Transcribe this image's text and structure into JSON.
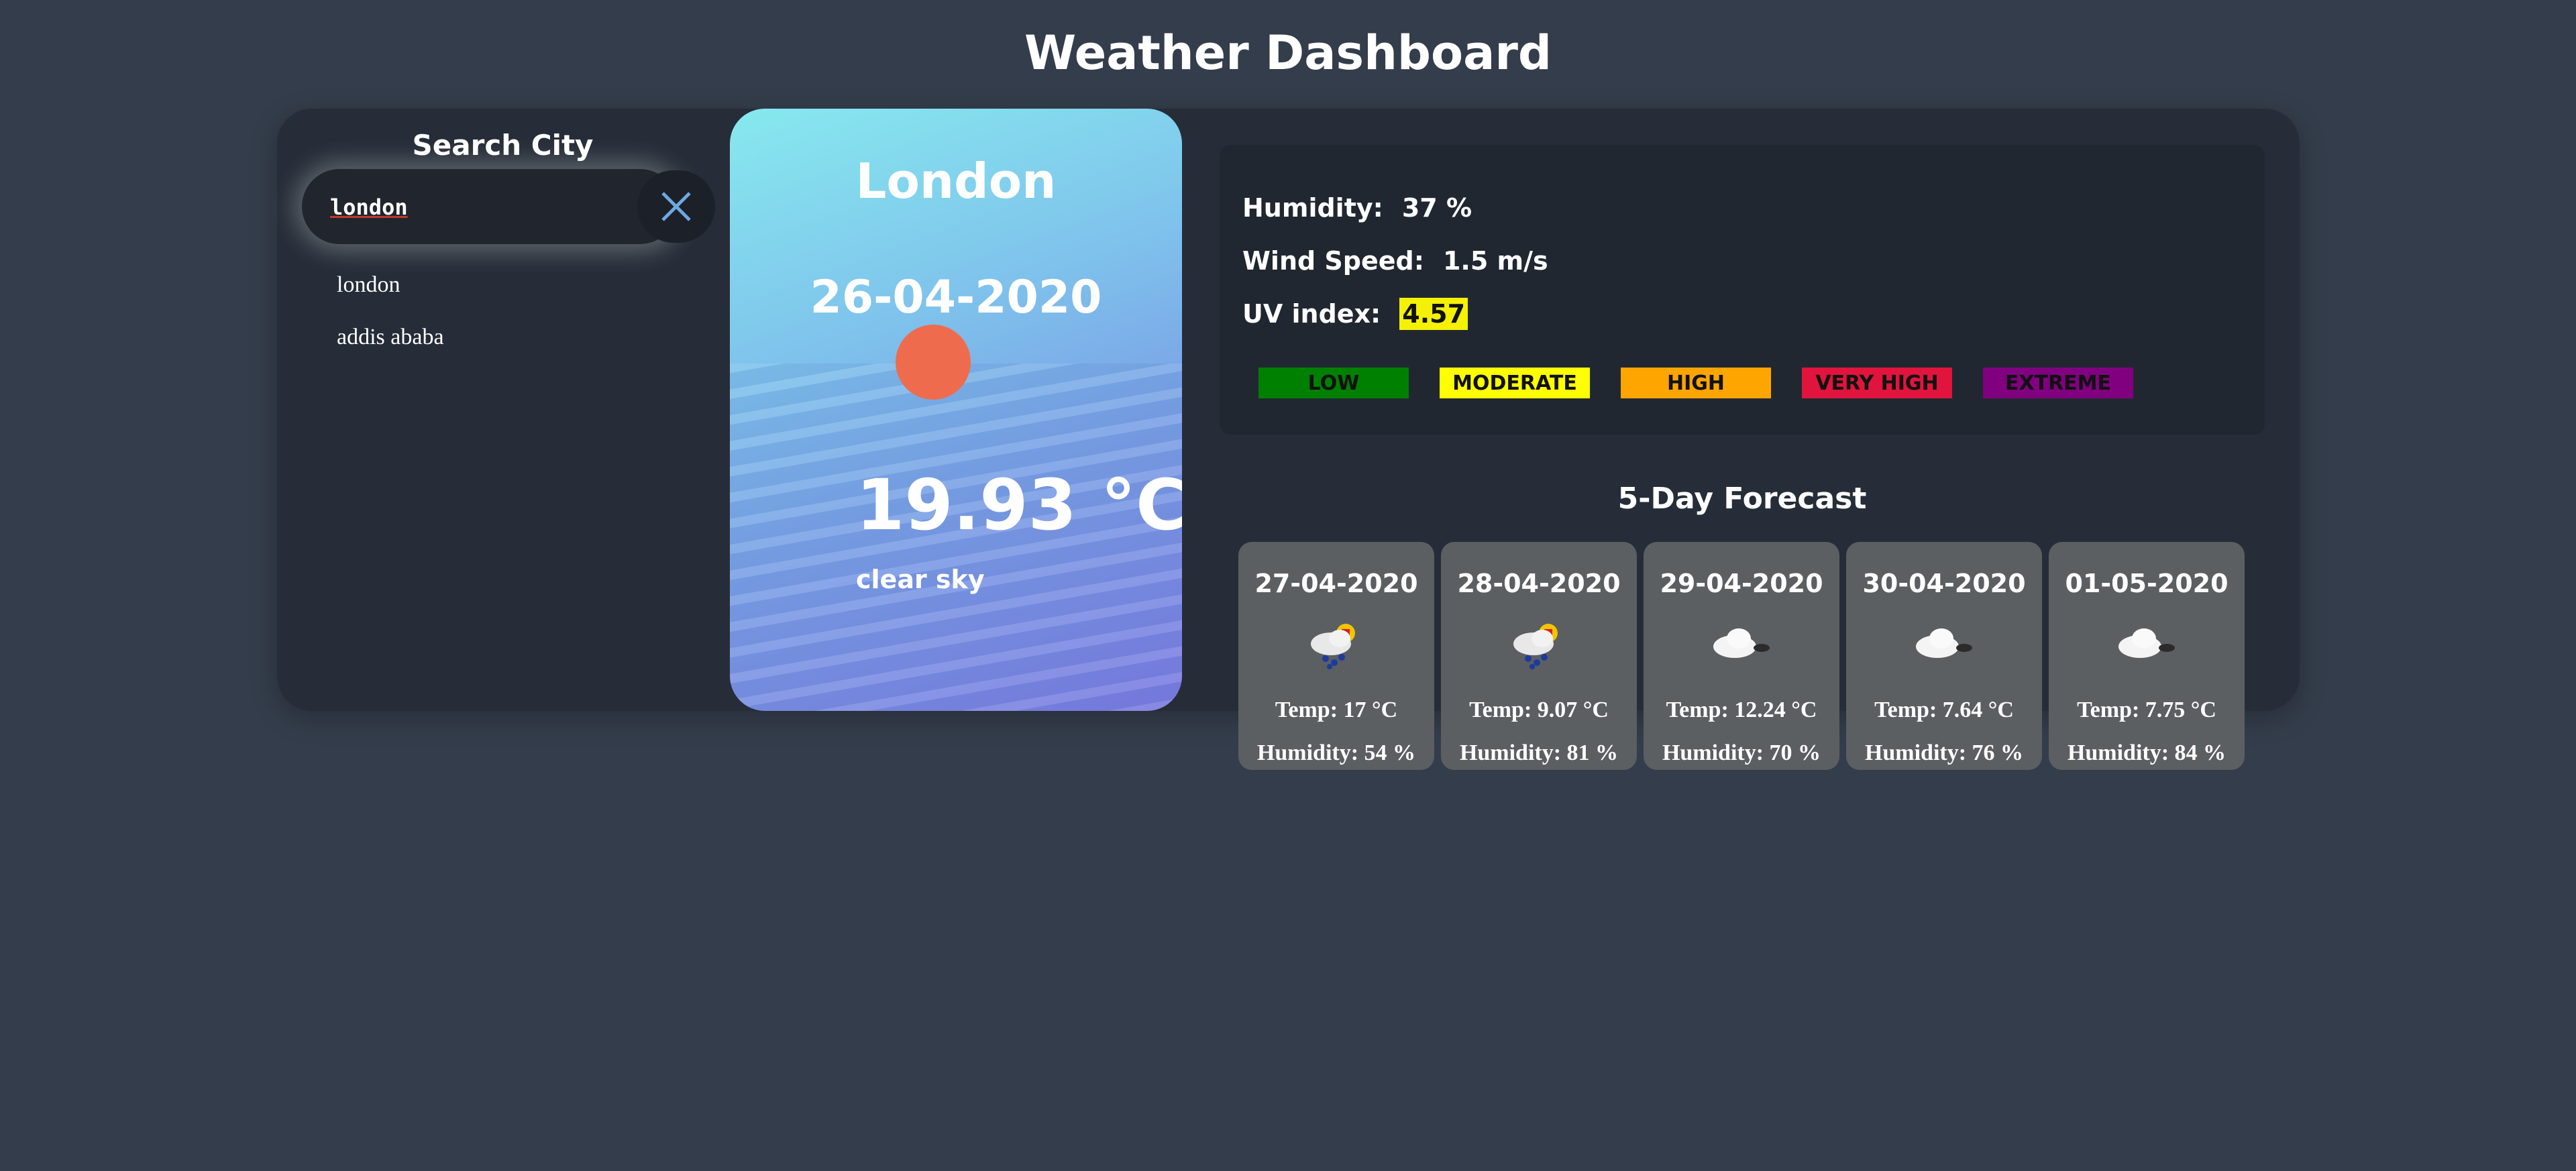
{
  "app": {
    "title": "Weather Dashboard"
  },
  "search": {
    "title": "Search City",
    "value": "london",
    "suggestions": [
      "london",
      "addis ababa"
    ]
  },
  "current": {
    "city": "London",
    "date": "26-04-2020",
    "temperature": "19.93 °C",
    "description": "clear sky"
  },
  "details": {
    "humidity_label": "Humidity:",
    "humidity_value": "37 %",
    "wind_label": "Wind Speed:",
    "wind_value": "1.5 m/s",
    "uv_label": "UV index:",
    "uv_value": "4.57",
    "uv_scale": [
      {
        "label": "LOW",
        "color": "#008000"
      },
      {
        "label": "MODERATE",
        "color": "#ffff00"
      },
      {
        "label": "HIGH",
        "color": "#ffa500"
      },
      {
        "label": "VERY HIGH",
        "color": "#e0143c"
      },
      {
        "label": "EXTREME",
        "color": "#800080"
      }
    ]
  },
  "forecast": {
    "title": "5-Day Forecast",
    "days": [
      {
        "date": "27-04-2020",
        "icon": "rain-sun-icon",
        "temp": "Temp: 17 °C",
        "humidity": "Humidity: 54 %"
      },
      {
        "date": "28-04-2020",
        "icon": "rain-sun-icon",
        "temp": "Temp: 9.07 °C",
        "humidity": "Humidity: 81 %"
      },
      {
        "date": "29-04-2020",
        "icon": "cloud-moon-icon",
        "temp": "Temp: 12.24 °C",
        "humidity": "Humidity: 70 %"
      },
      {
        "date": "30-04-2020",
        "icon": "cloud-moon-icon",
        "temp": "Temp: 7.64 °C",
        "humidity": "Humidity: 76 %"
      },
      {
        "date": "01-05-2020",
        "icon": "cloud-moon-icon",
        "temp": "Temp: 7.75 °C",
        "humidity": "Humidity: 84 %"
      }
    ]
  }
}
